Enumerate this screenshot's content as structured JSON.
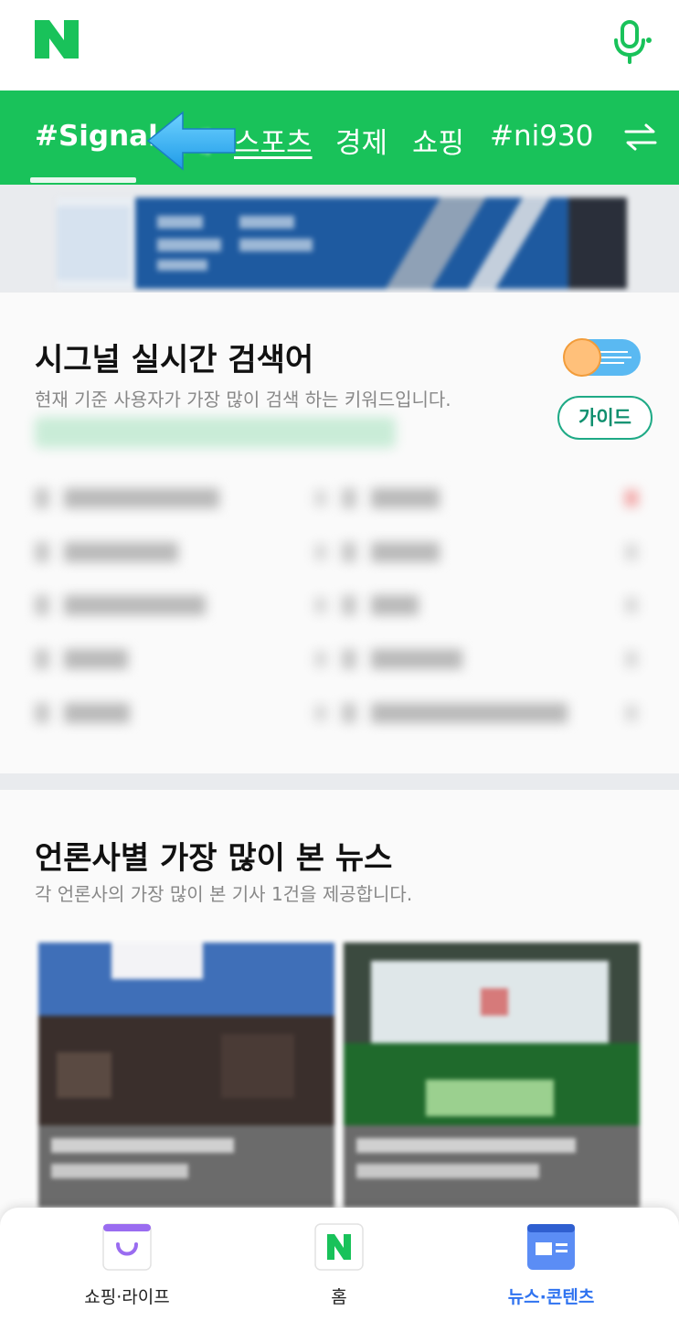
{
  "header": {
    "logo_letter": "N",
    "mic_icon": "microphone-icon"
  },
  "tabs": [
    {
      "label": "#Signal",
      "active": true
    },
    {
      "label": "연예",
      "blurred": true
    },
    {
      "label": "스포츠"
    },
    {
      "label": "경제"
    },
    {
      "label": "쇼핑"
    },
    {
      "label": "#ni930"
    }
  ],
  "swap_icon": "swap-arrows-icon",
  "signal_section": {
    "title": "시그널 실시간 검색어",
    "subtitle": "현재 기준 사용자가 가장 많이 검색 하는 키워드입니다.",
    "guide_button": "가이드"
  },
  "news_section": {
    "title": "언론사별 가장 많이 본 뉴스",
    "subtitle": "각 언론사의 가장 많이 본 기사 1건을 제공합니다."
  },
  "bottom_nav": [
    {
      "label": "쇼핑·라이프",
      "icon": "shopping-bag-icon"
    },
    {
      "label": "홈",
      "icon": "naver-home-icon"
    },
    {
      "label": "뉴스·콘텐츠",
      "icon": "news-content-icon",
      "active": true
    }
  ],
  "colors": {
    "brand_green": "#19c25a",
    "nav_active_blue": "#2f73f0",
    "guide_teal": "#1faa86"
  }
}
